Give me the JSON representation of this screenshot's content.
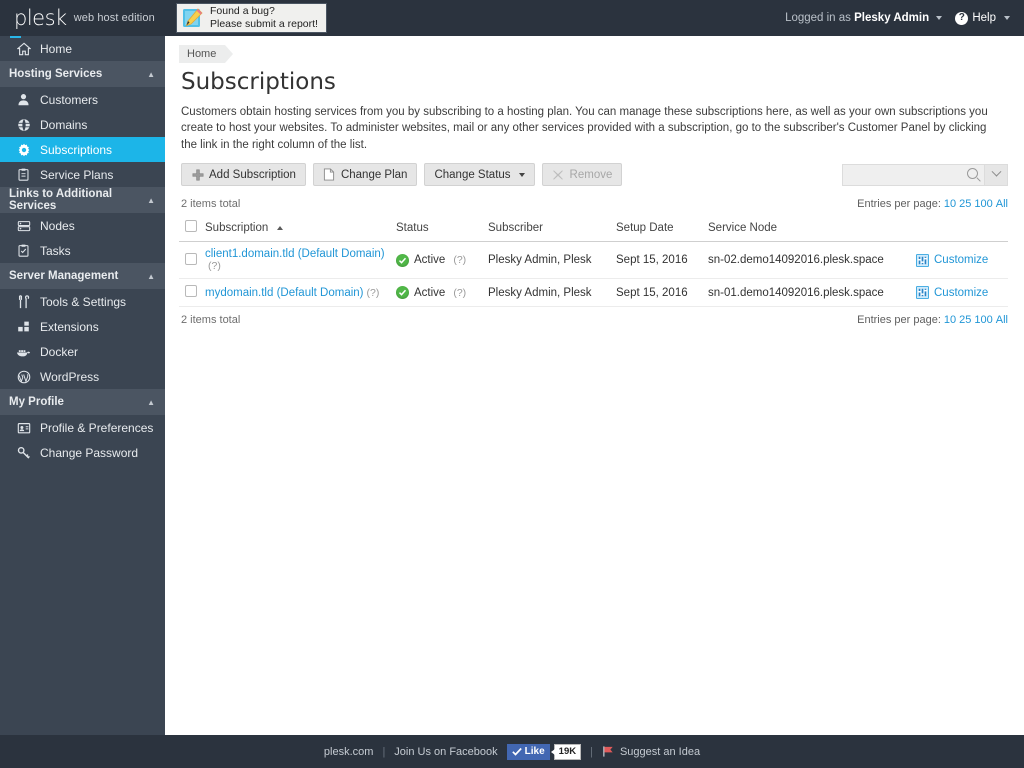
{
  "header": {
    "logo_text": "plesk",
    "logo_edition": "web host edition",
    "bug_banner": {
      "line1": "Found a bug?",
      "line2": "Please submit a report!",
      "icon": "pencil-note-icon"
    },
    "logged_in_label": "Logged in as",
    "user_name": "Plesky Admin",
    "help_label": "Help",
    "help_icon": "question-circle-icon"
  },
  "sidebar": {
    "items": [
      {
        "type": "item",
        "label": "Home",
        "icon": "home-icon",
        "active": false
      },
      {
        "type": "section",
        "label": "Hosting Services",
        "icon": "chevron-up-icon"
      },
      {
        "type": "item",
        "label": "Customers",
        "icon": "user-icon",
        "active": false
      },
      {
        "type": "item",
        "label": "Domains",
        "icon": "globe-icon",
        "active": false
      },
      {
        "type": "item",
        "label": "Subscriptions",
        "icon": "gear-icon",
        "active": true
      },
      {
        "type": "item",
        "label": "Service Plans",
        "icon": "clipboard-icon",
        "active": false
      },
      {
        "type": "section",
        "label": "Links to Additional Services",
        "icon": "chevron-up-icon"
      },
      {
        "type": "item",
        "label": "Nodes",
        "icon": "server-icon",
        "active": false
      },
      {
        "type": "item",
        "label": "Tasks",
        "icon": "checklist-icon",
        "active": false
      },
      {
        "type": "section",
        "label": "Server Management",
        "icon": "chevron-up-icon"
      },
      {
        "type": "item",
        "label": "Tools & Settings",
        "icon": "tools-icon",
        "active": false
      },
      {
        "type": "item",
        "label": "Extensions",
        "icon": "blocks-icon",
        "active": false
      },
      {
        "type": "item",
        "label": "Docker",
        "icon": "docker-whale-icon",
        "active": false
      },
      {
        "type": "item",
        "label": "WordPress",
        "icon": "wordpress-icon",
        "active": false
      },
      {
        "type": "section",
        "label": "My Profile",
        "icon": "chevron-up-icon"
      },
      {
        "type": "item",
        "label": "Profile & Preferences",
        "icon": "id-card-icon",
        "active": false
      },
      {
        "type": "item",
        "label": "Change Password",
        "icon": "key-icon",
        "active": false
      }
    ]
  },
  "main": {
    "breadcrumb": "Home",
    "title": "Subscriptions",
    "description": "Customers obtain hosting services from you by subscribing to a hosting plan. You can manage these subscriptions here, as well as your own subscriptions you create to host your websites. To administer websites, mail or any other services provided with a subscription, go to the subscriber's Customer Panel by clicking the link in the right column of the list.",
    "toolbar": {
      "add_label": "Add Subscription",
      "add_icon": "plus-icon",
      "change_plan_label": "Change Plan",
      "change_plan_icon": "document-icon",
      "change_status_label": "Change Status",
      "remove_label": "Remove",
      "remove_icon": "x-cross-icon",
      "remove_disabled": true
    },
    "search": {
      "value": "",
      "placeholder": "",
      "icon": "search-icon",
      "dropdown_icon": "chevron-down-icon"
    },
    "items_total": "2 items total",
    "entries_label": "Entries per page:",
    "entries_options": [
      "10",
      "25",
      "100",
      "All"
    ],
    "columns": [
      {
        "label": "Subscription",
        "sorted": "asc"
      },
      {
        "label": "Status"
      },
      {
        "label": "Subscriber"
      },
      {
        "label": "Setup Date"
      },
      {
        "label": "Service Node"
      }
    ],
    "rows": [
      {
        "name": "client1.domain.tld (Default Domain)",
        "name_hint": "(?)",
        "status": "Active",
        "status_hint": "(?)",
        "status_icon": "check-circle-icon",
        "subscriber": "Plesky Admin, Plesk",
        "setup_date": "Sept 15, 2016",
        "service_node": "sn-02.demo14092016.plesk.space",
        "customize_label": "Customize",
        "customize_icon": "sliders-icon"
      },
      {
        "name": "mydomain.tld (Default Domain)",
        "name_hint": "(?)",
        "status": "Active",
        "status_hint": "(?)",
        "status_icon": "check-circle-icon",
        "subscriber": "Plesky Admin, Plesk",
        "setup_date": "Sept 15, 2016",
        "service_node": "sn-01.demo14092016.plesk.space",
        "customize_label": "Customize",
        "customize_icon": "sliders-icon"
      }
    ]
  },
  "footer": {
    "site_link": "plesk.com",
    "facebook_label": "Join Us on Facebook",
    "like_label": "Like",
    "like_icon": "thumb-check-icon",
    "like_count": "19K",
    "suggest_label": "Suggest an Idea",
    "suggest_icon": "flag-icon"
  },
  "colors": {
    "sidebar_bg": "#3b4552",
    "topbar_bg": "#2b333e",
    "accent": "#1cb5e8",
    "link": "#2196d6",
    "status_green": "#51b848",
    "facebook_blue": "#4267b2"
  }
}
